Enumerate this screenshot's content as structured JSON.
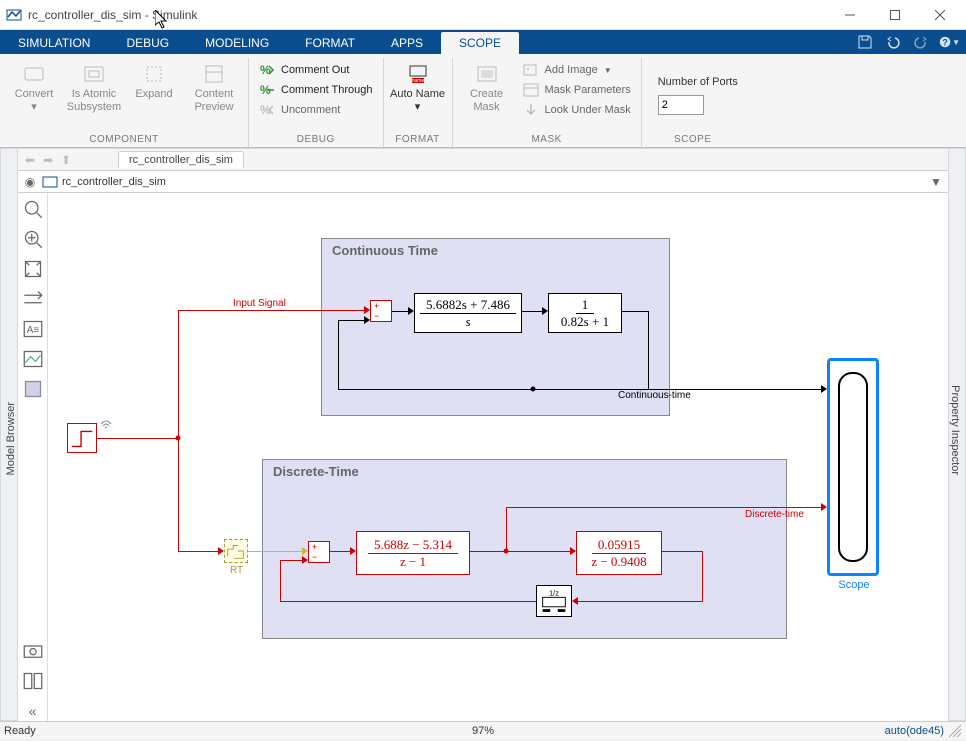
{
  "window": {
    "title": "rc_controller_dis_sim - Simulink"
  },
  "tabs": {
    "simulation": "SIMULATION",
    "debug": "DEBUG",
    "modeling": "MODELING",
    "format": "FORMAT",
    "apps": "APPS",
    "scope": "SCOPE"
  },
  "ribbon": {
    "component": {
      "caption": "COMPONENT",
      "convert": "Convert",
      "is_atomic": "Is Atomic Subsystem",
      "expand": "Expand",
      "content_preview": "Content Preview"
    },
    "debug": {
      "caption": "DEBUG",
      "comment_out": "Comment Out",
      "comment_through": "Comment Through",
      "uncomment": "Uncomment"
    },
    "format": {
      "caption": "FORMAT",
      "auto_name": "Auto Name"
    },
    "mask": {
      "caption": "MASK",
      "create_mask": "Create Mask",
      "add_image": "Add Image",
      "mask_parameters": "Mask Parameters",
      "look_under": "Look Under Mask"
    },
    "scope": {
      "caption": "SCOPE",
      "num_ports_label": "Number of Ports",
      "num_ports_value": "2"
    }
  },
  "explorer": {
    "model_tab": "rc_controller_dis_sim",
    "path": "rc_controller_dis_sim"
  },
  "side": {
    "left": "Model Browser",
    "right": "Property Inspector"
  },
  "diagram": {
    "continuous": {
      "title": "Continuous Time",
      "tf1_num": "5.6882s + 7.486",
      "tf1_den": "s",
      "tf2_num": "1",
      "tf2_den": "0.82s + 1",
      "signal_out": "Continuous-time"
    },
    "discrete": {
      "title": "Discrete-Time",
      "tf1_num": "5.688z − 5.314",
      "tf1_den": "z − 1",
      "tf2_num": "0.05915",
      "tf2_den": "z − 0.9408",
      "signal_out": "Discrete-time",
      "memory": "1/z"
    },
    "input_signal": "Input Signal",
    "rt_label": "RT",
    "scope_label": "Scope"
  },
  "status": {
    "ready": "Ready",
    "zoom": "97%",
    "solver": "auto(ode45)"
  }
}
